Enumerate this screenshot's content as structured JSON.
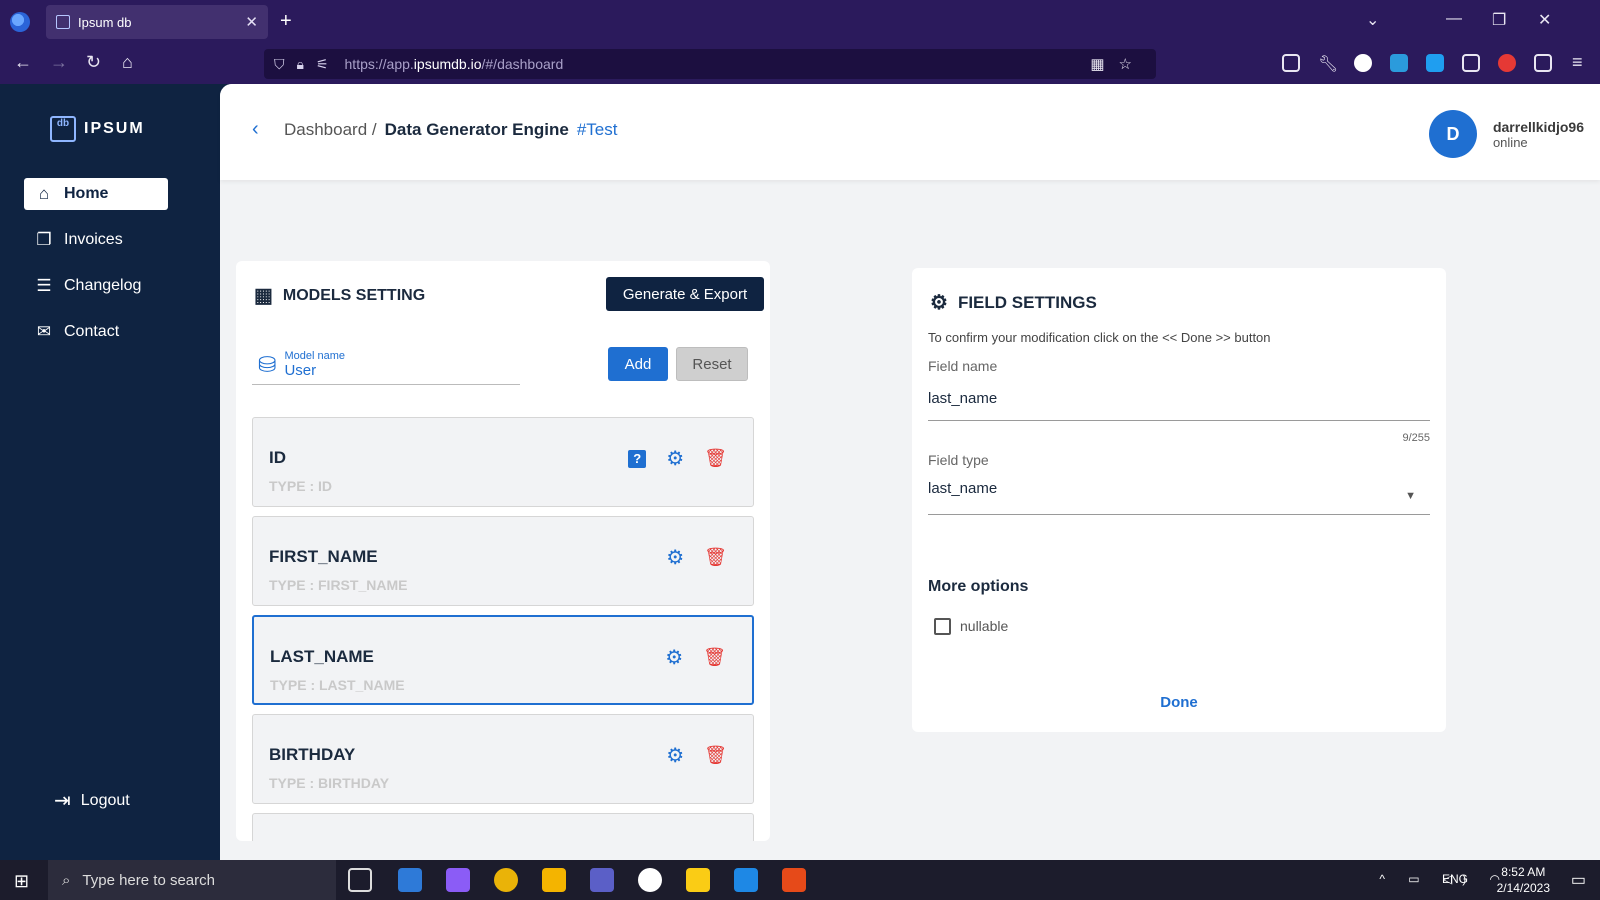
{
  "browser": {
    "tab_title": "Ipsum db",
    "tab_close": "✕",
    "new_tab": "+",
    "url_prefix": "https://app.",
    "url_domain": "ipsumdb.io",
    "url_suffix": "/#/dashboard"
  },
  "sidebar": {
    "brand": "IPSUM",
    "brand_logo": "db",
    "items": [
      {
        "label": "Home",
        "icon": "home-icon"
      },
      {
        "label": "Invoices",
        "icon": "invoices-icon"
      },
      {
        "label": "Changelog",
        "icon": "list-icon"
      },
      {
        "label": "Contact",
        "icon": "mail-icon"
      }
    ],
    "logout": "Logout"
  },
  "header": {
    "breadcrumb_root": "Dashboard /",
    "breadcrumb_current": "Data Generator Engine",
    "breadcrumb_tag": "#Test",
    "user_initial": "D",
    "user_name": "darrellkidjo96",
    "user_status": "online"
  },
  "models": {
    "title": "MODELS SETTING",
    "generate_label": "Generate & Export",
    "model_name_label": "Model name",
    "model_name_value": "User",
    "add_label": "Add",
    "reset_label": "Reset",
    "fields": [
      {
        "name": "ID",
        "type": "TYPE : ID",
        "help": "?"
      },
      {
        "name": "FIRST_NAME",
        "type": "TYPE : FIRST_NAME"
      },
      {
        "name": "LAST_NAME",
        "type": "TYPE : LAST_NAME"
      },
      {
        "name": "BIRTHDAY",
        "type": "TYPE : BIRTHDAY"
      }
    ]
  },
  "field_settings": {
    "title": "FIELD SETTINGS",
    "hint": "To confirm your modification click on the << Done >> button",
    "field_name_label": "Field name",
    "field_name_value": "last_name",
    "counter": "9/255",
    "field_type_label": "Field type",
    "field_type_value": "last_name",
    "more_options": "More options",
    "nullable_label": "nullable",
    "done_label": "Done"
  },
  "taskbar": {
    "search_placeholder": "Type here to search",
    "language": "ENG",
    "time": "8:52 AM",
    "date": "2/14/2023"
  },
  "colors": {
    "sidebar_bg": "#0f2341",
    "primary": "#1f6fd1",
    "danger": "#e53935",
    "browser_bg": "#2b1a5c"
  }
}
